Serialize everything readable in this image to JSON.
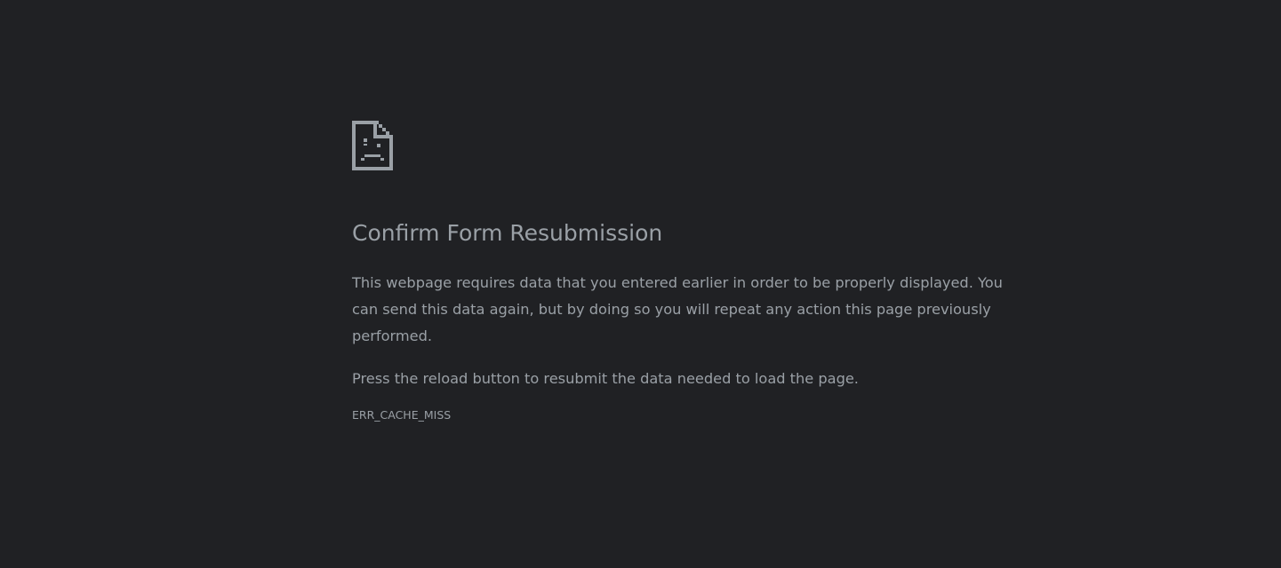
{
  "colors": {
    "background": "#202124",
    "text": "#9aa0a6"
  },
  "icon": {
    "name": "sad-document-icon"
  },
  "error": {
    "title": "Confirm Form Resubmission",
    "description": "This webpage requires data that you entered earlier in order to be properly displayed. You can send this data again, but by doing so you will repeat any action this page previously performed.",
    "instruction": "Press the reload button to resubmit the data needed to load the page.",
    "code": "ERR_CACHE_MISS"
  }
}
